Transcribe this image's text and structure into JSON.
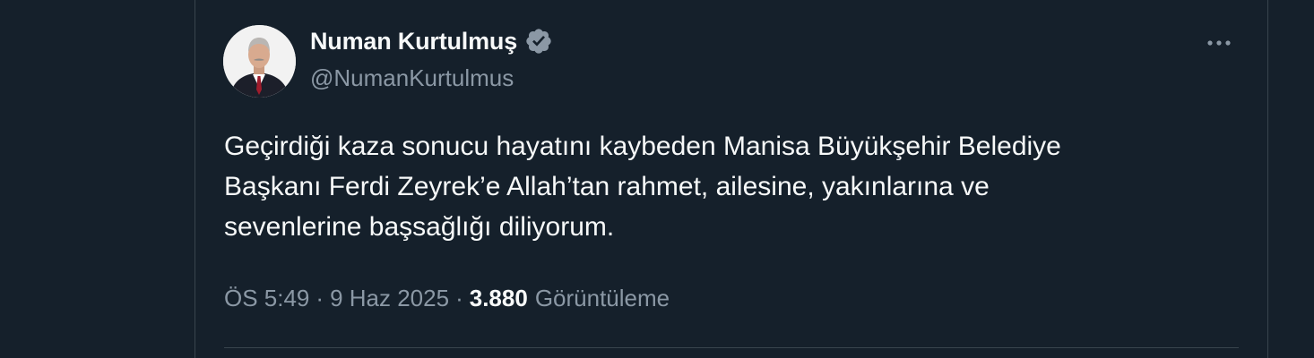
{
  "author": {
    "display_name": "Numan Kurtulmuş",
    "handle": "@NumanKurtulmus",
    "verified": true,
    "verified_badge_color": "#8b98a5",
    "avatar_icon": "profile-photo"
  },
  "more_icon": "more-options-icon",
  "tweet": {
    "lines": [
      "Geçirdiği kaza sonucu hayatını kaybeden Manisa Büyükşehir Belediye",
      "Başkanı Ferdi Zeyrek’e Allah’tan rahmet, ailesine, yakınlarına ve",
      "sevenlerine başsağlığı diliyorum."
    ]
  },
  "meta": {
    "time": "ÖS 5:49",
    "separator": "·",
    "date": "9 Haz 2025",
    "views_count": "3.880",
    "views_label": "Görüntüleme"
  },
  "colors": {
    "background": "#15202b",
    "text_primary": "#f7f9f9",
    "text_secondary": "#8b98a5",
    "border": "#38444d"
  }
}
